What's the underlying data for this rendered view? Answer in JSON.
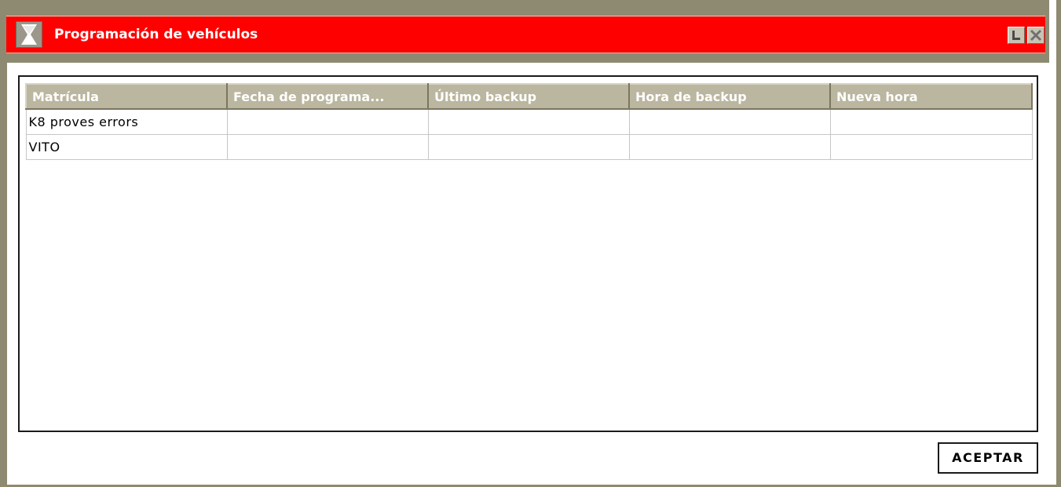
{
  "window": {
    "title": "Programación de vehículos",
    "icon": "hourglass-icon",
    "minimize_icon": "minimize-icon",
    "close_icon": "close-icon",
    "titlebar_color": "#ff0000",
    "frame_color": "#8e8a72"
  },
  "table": {
    "columns": [
      "Matrícula",
      "Fecha de programa...",
      "Último backup",
      "Hora de backup",
      "Nueva hora"
    ],
    "rows": [
      [
        "K8 proves errors",
        "",
        "",
        "",
        ""
      ],
      [
        "VITO",
        "",
        "",
        "",
        ""
      ]
    ],
    "header_color": "#bab69f"
  },
  "footer": {
    "accept_label": "ACEPTAR"
  }
}
